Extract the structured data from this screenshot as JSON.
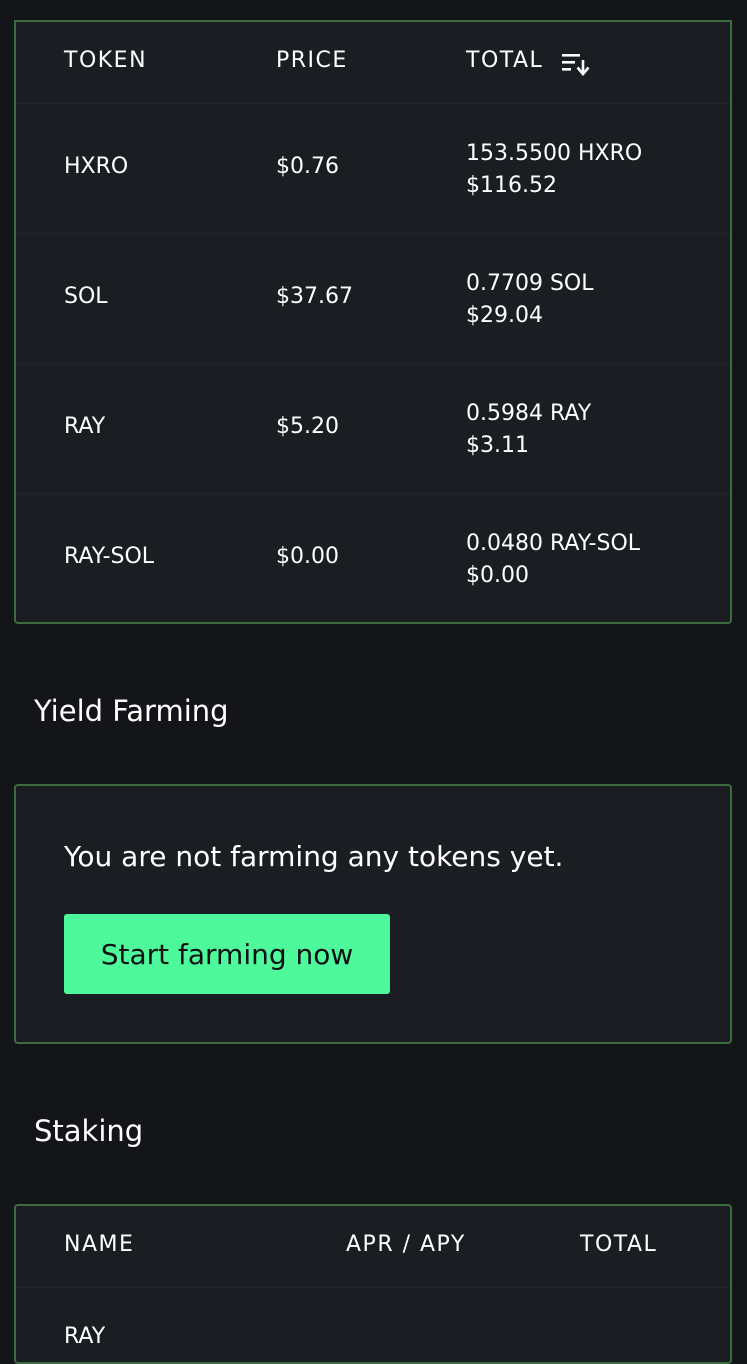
{
  "token_table": {
    "headers": {
      "token": "TOKEN",
      "price": "PRICE",
      "total": "TOTAL"
    },
    "sort_icon": "sort-descending-icon",
    "rows": [
      {
        "token": "HXRO",
        "price": "$0.76",
        "amount": "153.5500 HXRO",
        "value": "$116.52"
      },
      {
        "token": "SOL",
        "price": "$37.67",
        "amount": "0.7709 SOL",
        "value": "$29.04"
      },
      {
        "token": "RAY",
        "price": "$5.20",
        "amount": "0.5984 RAY",
        "value": "$3.11"
      },
      {
        "token": "RAY-SOL",
        "price": "$0.00",
        "amount": "0.0480 RAY-SOL",
        "value": "$0.00"
      }
    ]
  },
  "yield_farming": {
    "title": "Yield Farming",
    "empty_message": "You are not farming any tokens yet.",
    "cta_label": "Start farming now"
  },
  "staking": {
    "title": "Staking",
    "headers": {
      "name": "NAME",
      "apr_apy": "APR / APY",
      "total": "TOTAL"
    },
    "first_row_name": "RAY"
  },
  "colors": {
    "background": "#131519",
    "panel": "#1a1d22",
    "panel_border": "#3b6b3e",
    "accent": "#4df99a"
  }
}
